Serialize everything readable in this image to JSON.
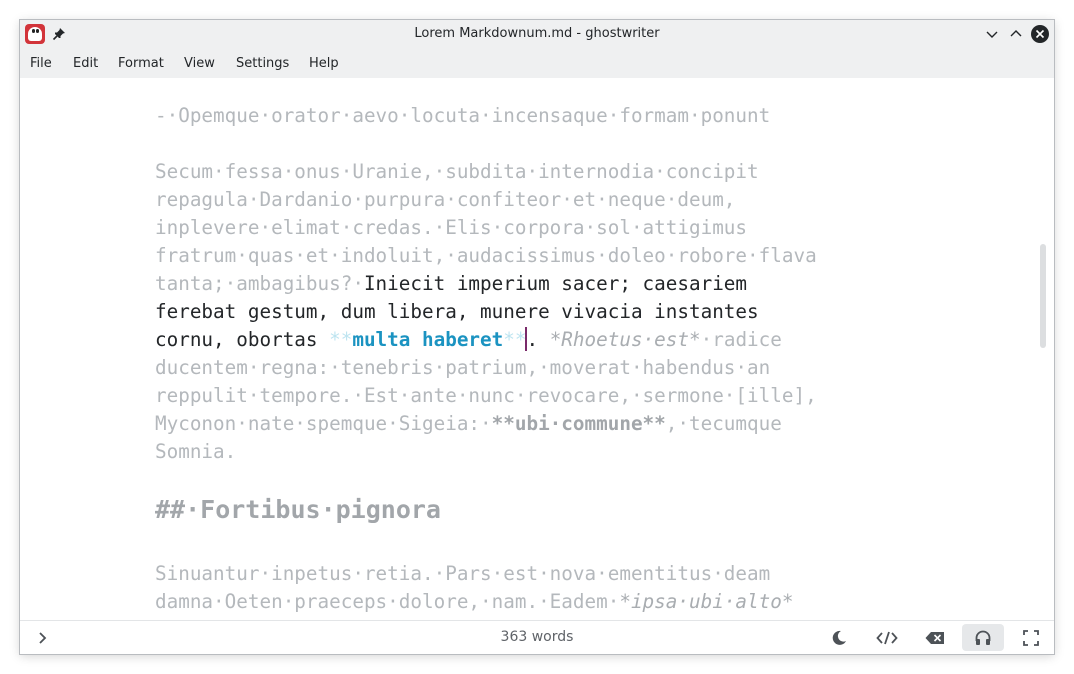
{
  "window": {
    "title": "Lorem Markdownum.md - ghostwriter"
  },
  "icons": {
    "app": "ghostwriter-app-icon",
    "pin": "pin-icon",
    "minimize": "chevron-down-icon",
    "maximize": "chevron-up-icon",
    "close": "close-icon",
    "sidebar_toggle": "chevron-right-icon",
    "theme": "moon-icon",
    "html_preview": "code-icon",
    "hemingway": "backspace-icon",
    "focus_mode": "headphones-icon",
    "fullscreen": "fullscreen-icon"
  },
  "menubar": {
    "items": [
      "File",
      "Edit",
      "Format",
      "View",
      "Settings",
      "Help"
    ]
  },
  "editor": {
    "lines": [
      "-·Opemque·orator·aevo·locuta·incensaque·formam·ponunt",
      "Secum·fessa·onus·Uranie,·subdita·internodia·concipit",
      "repagula·Dardanio·purpura·confiteor·et·neque·deum,",
      "inplevere·elimat·credas.·Elis·corpora·sol·attigimus",
      "fratrum·quas·et·indoluit,·audacissimus·doleo·robore·flava"
    ],
    "line5": {
      "dim": "tanta;·ambagibus?·",
      "focus": "Iniecit imperium sacer; caesariem"
    },
    "line6": "ferebat gestum, dum libera, munere vivacia instantes",
    "line7": {
      "focus_before": "cornu, obortas ",
      "marker_open": "**",
      "bold_text": "multa haberet",
      "marker_close": "**",
      "focus_after": ".",
      "italic": " *Rhoetus·est*",
      "dim_after": "·radice"
    },
    "line8": "ducentem·regna:·tenebris·patrium,·moverat·habendus·an",
    "line9": "reppulit·tempore.·Est·ante·nunc·revocare,·sermone·[ille],",
    "line10": {
      "dim_before": "Myconon·nate·spemque·Sigeia:·",
      "bold": "**ubi·commune**",
      "dim_after": ",·tecumque"
    },
    "line11": "Somnia.",
    "heading": "##·Fortibus·pignora",
    "line12": "Sinuantur·inpetus·retia.·Pars·est·nova·ementitus·deam",
    "line13": {
      "dim": "damna·Oeten·praeceps·dolore,·nam.·Eadem·",
      "italic": "*ipsa·ubi·alto*"
    }
  },
  "statusbar": {
    "word_count": "363 words"
  },
  "colors": {
    "chrome_bg": "#eff0f1",
    "text_dim": "#b4b8bc",
    "text_focus": "#232629",
    "bold_accent": "#1b93c1",
    "cursor": "#7a2a6a"
  }
}
